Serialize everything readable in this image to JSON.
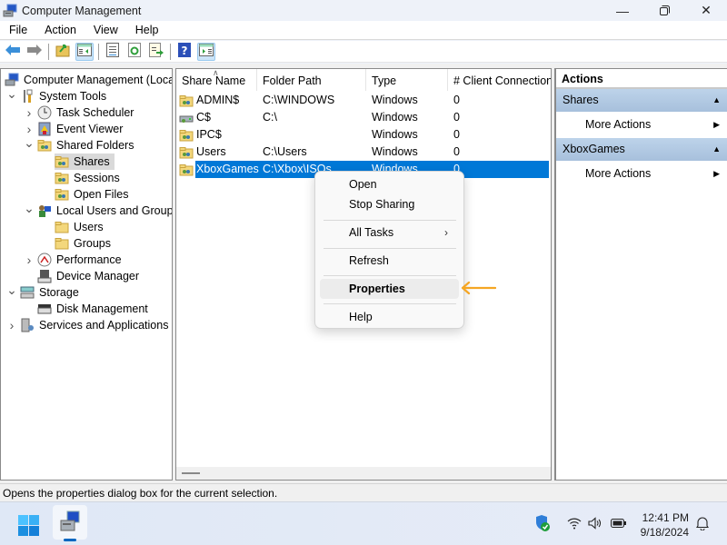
{
  "window": {
    "title": "Computer Management",
    "controls": {
      "minimize": "minimize-icon",
      "maximize": "restore-icon",
      "close": "close-icon"
    }
  },
  "menubar": {
    "items": [
      "File",
      "Action",
      "View",
      "Help"
    ]
  },
  "toolbar": {
    "buttons": [
      {
        "icon": "back-arrow-icon",
        "active": false
      },
      {
        "icon": "forward-arrow-icon",
        "active": false
      },
      {
        "icon": "up-folder-icon",
        "active": false
      },
      {
        "icon": "show-hide-console-tree-icon",
        "active": true
      },
      {
        "icon": "properties-icon",
        "active": false
      },
      {
        "icon": "refresh-icon",
        "active": false
      },
      {
        "icon": "export-list-icon",
        "active": false
      },
      {
        "icon": "help-icon",
        "active": false
      },
      {
        "icon": "show-hide-action-pane-icon",
        "active": true
      }
    ]
  },
  "tree": {
    "items": [
      {
        "label": "Computer Management (Local",
        "level": 0,
        "expander": "none",
        "icon": "computer-management-icon"
      },
      {
        "label": "System Tools",
        "level": 1,
        "expander": "expanded",
        "icon": "tools-icon"
      },
      {
        "label": "Task Scheduler",
        "level": 2,
        "expander": "collapsed",
        "icon": "clock-icon"
      },
      {
        "label": "Event Viewer",
        "level": 2,
        "expander": "collapsed",
        "icon": "event-viewer-icon"
      },
      {
        "label": "Shared Folders",
        "level": 2,
        "expander": "expanded",
        "icon": "shared-folder-icon"
      },
      {
        "label": "Shares",
        "level": 3,
        "expander": "none",
        "icon": "shared-folder-icon",
        "selected": true
      },
      {
        "label": "Sessions",
        "level": 3,
        "expander": "none",
        "icon": "shared-folder-icon"
      },
      {
        "label": "Open Files",
        "level": 3,
        "expander": "none",
        "icon": "shared-folder-icon"
      },
      {
        "label": "Local Users and Groups",
        "level": 2,
        "expander": "expanded",
        "icon": "users-icon"
      },
      {
        "label": "Users",
        "level": 3,
        "expander": "none",
        "icon": "folder-icon"
      },
      {
        "label": "Groups",
        "level": 3,
        "expander": "none",
        "icon": "folder-icon"
      },
      {
        "label": "Performance",
        "level": 2,
        "expander": "collapsed",
        "icon": "performance-icon"
      },
      {
        "label": "Device Manager",
        "level": 2,
        "expander": "none",
        "icon": "device-manager-icon"
      },
      {
        "label": "Storage",
        "level": 1,
        "expander": "expanded",
        "icon": "storage-icon"
      },
      {
        "label": "Disk Management",
        "level": 2,
        "expander": "none",
        "icon": "disk-management-icon"
      },
      {
        "label": "Services and Applications",
        "level": 1,
        "expander": "collapsed",
        "icon": "services-icon"
      }
    ]
  },
  "list": {
    "columns": [
      "Share Name",
      "Folder Path",
      "Type",
      "# Client Connection"
    ],
    "sort_column": "Share Name",
    "rows": [
      {
        "name": "ADMIN$",
        "path": "C:\\WINDOWS",
        "type": "Windows",
        "clients": "0",
        "icon": "shared-folder-icon"
      },
      {
        "name": "C$",
        "path": "C:\\",
        "type": "Windows",
        "clients": "0",
        "icon": "shared-drive-icon"
      },
      {
        "name": "IPC$",
        "path": "",
        "type": "Windows",
        "clients": "0",
        "icon": "shared-folder-icon"
      },
      {
        "name": "Users",
        "path": "C:\\Users",
        "type": "Windows",
        "clients": "0",
        "icon": "shared-folder-icon"
      },
      {
        "name": "XboxGames",
        "path": "C:\\Xbox\\ISOs",
        "type": "Windows",
        "clients": "0",
        "icon": "shared-folder-icon",
        "selected": true
      }
    ]
  },
  "actions": {
    "title": "Actions",
    "groups": [
      {
        "label": "Shares",
        "items": [
          "More Actions"
        ]
      },
      {
        "label": "XboxGames",
        "items": [
          "More Actions"
        ]
      }
    ]
  },
  "context_menu": {
    "items": [
      {
        "label": "Open"
      },
      {
        "label": "Stop Sharing"
      },
      {
        "separator": true
      },
      {
        "label": "All Tasks",
        "submenu": true
      },
      {
        "separator": true
      },
      {
        "label": "Refresh"
      },
      {
        "separator": true
      },
      {
        "label": "Properties",
        "highlighted": true
      },
      {
        "separator": true
      },
      {
        "label": "Help"
      }
    ],
    "annotation": {
      "icon": "pointer-arrow-icon",
      "color": "#f5a623"
    }
  },
  "statusbar": {
    "text": "Opens the properties dialog box for the current selection."
  },
  "taskbar": {
    "start": "windows-start-icon",
    "apps": [
      {
        "name": "Computer Management",
        "icon": "computer-management-icon",
        "active": true
      }
    ],
    "tray": [
      "windows-security-icon",
      "wifi-icon",
      "volume-icon",
      "battery-icon"
    ],
    "time": "12:41 PM",
    "date": "9/18/2024",
    "notification": "bell-icon"
  },
  "colors": {
    "selection": "#0078d7",
    "accent": "#0067c0",
    "annotation": "#f5a623"
  }
}
